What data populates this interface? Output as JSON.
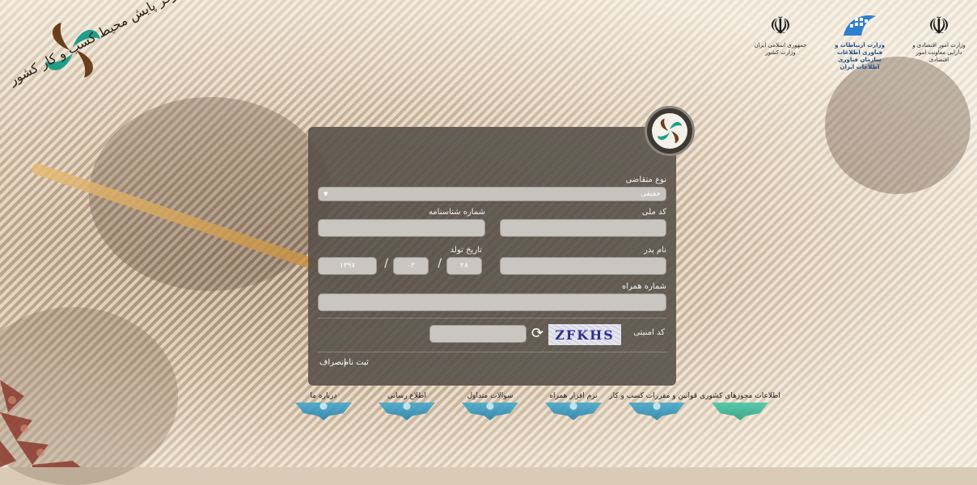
{
  "brand": {
    "left_logo_text": "مرکز پایش محیط کسب و کار کشور"
  },
  "top_logos": [
    {
      "name": "mefa",
      "caption": "وزارت امور اقتصادی و دارایی معاونت امور اقتصادی"
    },
    {
      "name": "itc",
      "caption": "وزارت ارتباطات و فناوری اطلاعات سازمان فناوری اطلاعات ایران"
    },
    {
      "name": "interior",
      "caption": "جمهوری اسلامی ایران وزارت کشور"
    }
  ],
  "form": {
    "applicant_type_label": "نوع متقاضی",
    "applicant_type_value": "حقیقی",
    "national_code_label": "کد ملی",
    "national_code_value": "",
    "id_number_label": "شماره شناسنامه",
    "id_number_value": "",
    "father_name_label": "نام پدر",
    "father_name_value": "",
    "birth_date_label": "تاریخ تولد",
    "birth_day": "۲۸",
    "birth_month": "۰۲",
    "birth_year": "۱۳۹۷",
    "date_separator": "/",
    "mobile_label": "شماره همراه",
    "mobile_value": "",
    "captcha_label": "کد امنیتی",
    "captcha_text": "ZFKHS",
    "captcha_input_value": "",
    "register_button": "ثبت نام",
    "cancel_button": "انصراف"
  },
  "menu": [
    {
      "label": "اطلاعات مجوزهای کشوری",
      "color": "green"
    },
    {
      "label": "قوانین و مقررات کسب و کار",
      "color": "blue"
    },
    {
      "label": "نرم افزار همراه",
      "color": "blue"
    },
    {
      "label": "سوالات متداول",
      "color": "blue"
    },
    {
      "label": "اطلاع رسانی",
      "color": "blue"
    },
    {
      "label": "درباره ما",
      "color": "blue"
    }
  ],
  "icons": {
    "dropdown_arrow": "▼",
    "refresh": "⟳",
    "emblem": "☫"
  }
}
